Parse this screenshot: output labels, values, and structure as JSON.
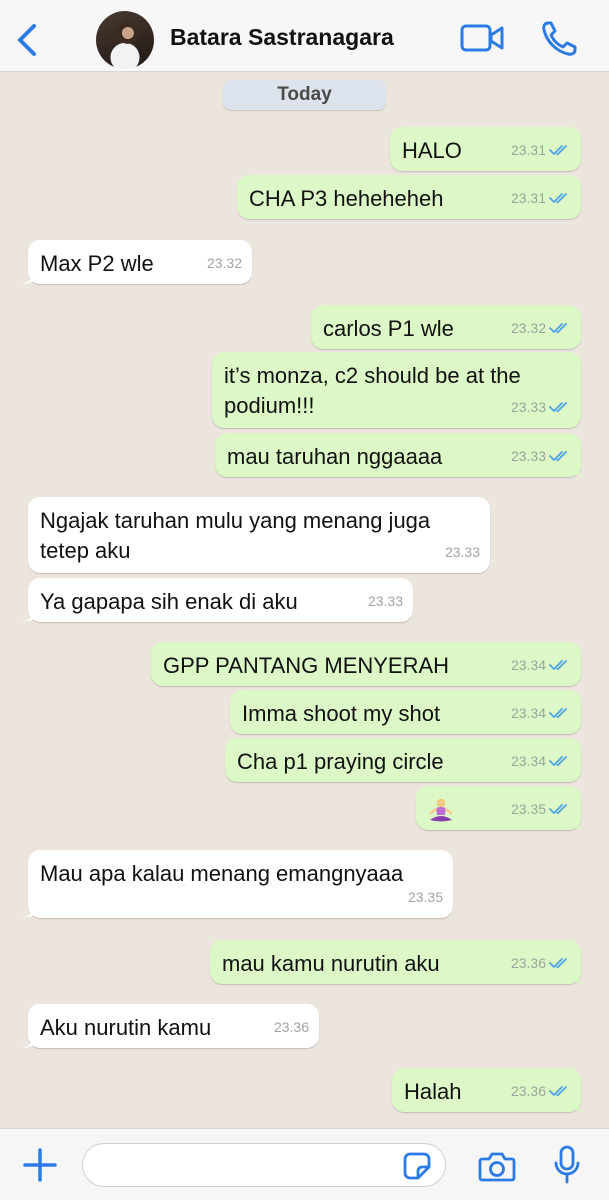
{
  "header": {
    "contact_name": "Batara Sastranagara",
    "icons": {
      "back": "chevron-left-icon",
      "video": "video-camera-icon",
      "call": "phone-icon"
    }
  },
  "date_separator": "Today",
  "colors": {
    "accent": "#2c7be5",
    "outgoing_bubble": "#dcf8c6",
    "incoming_bubble": "#ffffff",
    "chat_background": "#ece5dd",
    "read_ticks": "#4fa3e8"
  },
  "messages": [
    {
      "dir": "out",
      "text": "HALO",
      "time": "23.31",
      "read": true
    },
    {
      "dir": "out",
      "text": "CHA P3 heheheheh",
      "time": "23.31",
      "read": true
    },
    {
      "dir": "in",
      "text": "Max P2 wle",
      "time": "23.32"
    },
    {
      "dir": "out",
      "text": "carlos P1 wle",
      "time": "23.32",
      "read": true
    },
    {
      "dir": "out",
      "text": "it’s monza, c2 should be at the podium!!!",
      "time": "23.33",
      "read": true
    },
    {
      "dir": "out",
      "text": "mau taruhan nggaaaa",
      "time": "23.33",
      "read": true
    },
    {
      "dir": "in",
      "text": "Ngajak taruhan mulu yang menang juga tetep aku",
      "time": "23.33"
    },
    {
      "dir": "in",
      "text": "Ya gapapa sih enak di aku",
      "time": "23.33"
    },
    {
      "dir": "out",
      "text": "GPP PANTANG MENYERAH",
      "time": "23.34",
      "read": true
    },
    {
      "dir": "out",
      "text": "Imma shoot my shot",
      "time": "23.34",
      "read": true
    },
    {
      "dir": "out",
      "text": "Cha p1 praying circle",
      "time": "23.34",
      "read": true
    },
    {
      "dir": "out",
      "text": "",
      "emoji": "yoga-meditation-emoji",
      "time": "23.35",
      "read": true
    },
    {
      "dir": "in",
      "text": "Mau apa kalau menang emangnyaaa",
      "time": "23.35"
    },
    {
      "dir": "out",
      "text": "mau kamu nurutin aku",
      "time": "23.36",
      "read": true
    },
    {
      "dir": "in",
      "text": "Aku nurutin kamu",
      "time": "23.36"
    },
    {
      "dir": "out",
      "text": "Halah",
      "time": "23.36",
      "read": true
    }
  ],
  "composer": {
    "placeholder": "",
    "icons": {
      "attach": "plus-icon",
      "sticker": "sticker-icon",
      "camera": "camera-icon",
      "mic": "microphone-icon"
    }
  }
}
